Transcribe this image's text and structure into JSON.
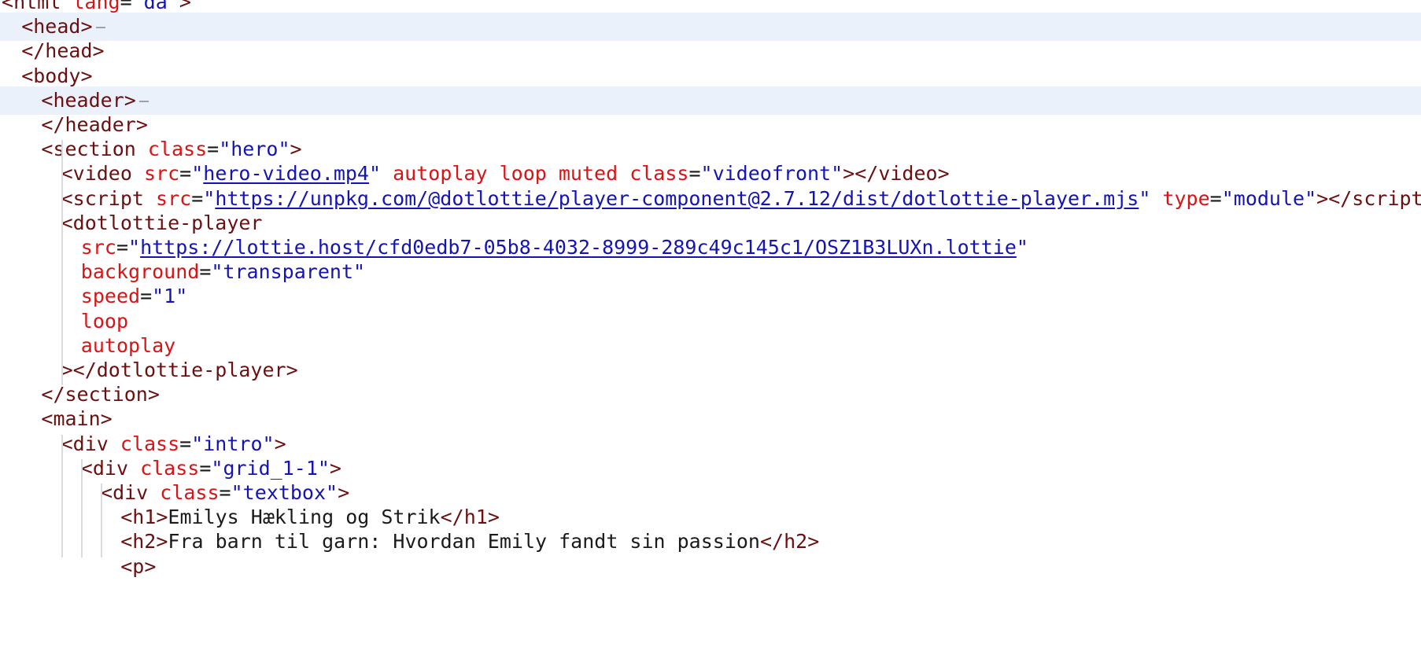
{
  "editor": {
    "lines": [
      {
        "indent": 0,
        "tokens": [
          {
            "t": "br",
            "v": "<"
          },
          {
            "t": "tag",
            "v": "html"
          },
          {
            "t": "txt",
            "v": " "
          },
          {
            "t": "attr",
            "v": "lang"
          },
          {
            "t": "txt",
            "v": "="
          },
          {
            "t": "val",
            "v": "\"da\""
          },
          {
            "t": "br",
            "v": ">"
          }
        ]
      },
      {
        "indent": 1,
        "highlight": true,
        "fold": true,
        "tokens": [
          {
            "t": "br",
            "v": "<"
          },
          {
            "t": "tag",
            "v": "head"
          },
          {
            "t": "br",
            "v": ">"
          }
        ]
      },
      {
        "indent": 1,
        "tokens": [
          {
            "t": "br",
            "v": "</"
          },
          {
            "t": "tag",
            "v": "head"
          },
          {
            "t": "br",
            "v": ">"
          }
        ]
      },
      {
        "indent": 1,
        "tokens": [
          {
            "t": "br",
            "v": "<"
          },
          {
            "t": "tag",
            "v": "body"
          },
          {
            "t": "br",
            "v": ">"
          }
        ]
      },
      {
        "indent": 2,
        "highlight": true,
        "fold": true,
        "tokens": [
          {
            "t": "br",
            "v": "<"
          },
          {
            "t": "tag",
            "v": "header"
          },
          {
            "t": "br",
            "v": ">"
          }
        ]
      },
      {
        "indent": 2,
        "tokens": [
          {
            "t": "br",
            "v": "</"
          },
          {
            "t": "tag",
            "v": "header"
          },
          {
            "t": "br",
            "v": ">"
          }
        ]
      },
      {
        "indent": 2,
        "tokens": [
          {
            "t": "br",
            "v": "<"
          },
          {
            "t": "tag",
            "v": "section"
          },
          {
            "t": "txt",
            "v": " "
          },
          {
            "t": "attr",
            "v": "class"
          },
          {
            "t": "txt",
            "v": "="
          },
          {
            "t": "val",
            "v": "\"hero\""
          },
          {
            "t": "br",
            "v": ">"
          }
        ]
      },
      {
        "indent": 3,
        "tokens": [
          {
            "t": "br",
            "v": "<"
          },
          {
            "t": "tag",
            "v": "video"
          },
          {
            "t": "txt",
            "v": " "
          },
          {
            "t": "attr",
            "v": "src"
          },
          {
            "t": "txt",
            "v": "="
          },
          {
            "t": "val",
            "v": "\""
          },
          {
            "t": "link",
            "v": "hero-video.mp4"
          },
          {
            "t": "val",
            "v": "\""
          },
          {
            "t": "txt",
            "v": " "
          },
          {
            "t": "attr",
            "v": "autoplay"
          },
          {
            "t": "txt",
            "v": " "
          },
          {
            "t": "attr",
            "v": "loop"
          },
          {
            "t": "txt",
            "v": " "
          },
          {
            "t": "attr",
            "v": "muted"
          },
          {
            "t": "txt",
            "v": " "
          },
          {
            "t": "attr",
            "v": "class"
          },
          {
            "t": "txt",
            "v": "="
          },
          {
            "t": "val",
            "v": "\"videofront\""
          },
          {
            "t": "br",
            "v": "></"
          },
          {
            "t": "tag",
            "v": "video"
          },
          {
            "t": "br",
            "v": ">"
          }
        ]
      },
      {
        "indent": 3,
        "tokens": [
          {
            "t": "br",
            "v": "<"
          },
          {
            "t": "tag",
            "v": "script"
          },
          {
            "t": "txt",
            "v": " "
          },
          {
            "t": "attr",
            "v": "src"
          },
          {
            "t": "txt",
            "v": "="
          },
          {
            "t": "val",
            "v": "\""
          },
          {
            "t": "link",
            "v": "https://unpkg.com/@dotlottie/player-component@2.7.12/dist/dotlottie-player.mjs"
          },
          {
            "t": "val",
            "v": "\""
          },
          {
            "t": "txt",
            "v": " "
          },
          {
            "t": "attr",
            "v": "type"
          },
          {
            "t": "txt",
            "v": "="
          },
          {
            "t": "val",
            "v": "\"module\""
          },
          {
            "t": "br",
            "v": "></"
          },
          {
            "t": "tag",
            "v": "script"
          },
          {
            "t": "br",
            "v": ">"
          }
        ]
      },
      {
        "indent": 3,
        "tokens": [
          {
            "t": "br",
            "v": "<"
          },
          {
            "t": "tag",
            "v": "dotlottie-player"
          }
        ]
      },
      {
        "indent": 4,
        "tokens": [
          {
            "t": "attr",
            "v": "src"
          },
          {
            "t": "txt",
            "v": "="
          },
          {
            "t": "val",
            "v": "\""
          },
          {
            "t": "link",
            "v": "https://lottie.host/cfd0edb7-05b8-4032-8999-289c49c145c1/OSZ1B3LUXn.lottie"
          },
          {
            "t": "val",
            "v": "\""
          }
        ]
      },
      {
        "indent": 4,
        "tokens": [
          {
            "t": "attr",
            "v": "background"
          },
          {
            "t": "txt",
            "v": "="
          },
          {
            "t": "val",
            "v": "\"transparent\""
          }
        ]
      },
      {
        "indent": 4,
        "tokens": [
          {
            "t": "attr",
            "v": "speed"
          },
          {
            "t": "txt",
            "v": "="
          },
          {
            "t": "val",
            "v": "\"1\""
          }
        ]
      },
      {
        "indent": 4,
        "tokens": [
          {
            "t": "attr",
            "v": "loop"
          }
        ]
      },
      {
        "indent": 4,
        "tokens": [
          {
            "t": "attr",
            "v": "autoplay"
          }
        ]
      },
      {
        "indent": 3,
        "tokens": [
          {
            "t": "br",
            "v": "></"
          },
          {
            "t": "tag",
            "v": "dotlottie-player"
          },
          {
            "t": "br",
            "v": ">"
          }
        ]
      },
      {
        "indent": 2,
        "tokens": [
          {
            "t": "br",
            "v": "</"
          },
          {
            "t": "tag",
            "v": "section"
          },
          {
            "t": "br",
            "v": ">"
          }
        ]
      },
      {
        "indent": 2,
        "tokens": [
          {
            "t": "br",
            "v": "<"
          },
          {
            "t": "tag",
            "v": "main"
          },
          {
            "t": "br",
            "v": ">"
          }
        ]
      },
      {
        "indent": 3,
        "tokens": [
          {
            "t": "br",
            "v": "<"
          },
          {
            "t": "tag",
            "v": "div"
          },
          {
            "t": "txt",
            "v": " "
          },
          {
            "t": "attr",
            "v": "class"
          },
          {
            "t": "txt",
            "v": "="
          },
          {
            "t": "val",
            "v": "\"intro\""
          },
          {
            "t": "br",
            "v": ">"
          }
        ]
      },
      {
        "indent": 4,
        "tokens": [
          {
            "t": "br",
            "v": "<"
          },
          {
            "t": "tag",
            "v": "div"
          },
          {
            "t": "txt",
            "v": " "
          },
          {
            "t": "attr",
            "v": "class"
          },
          {
            "t": "txt",
            "v": "="
          },
          {
            "t": "val",
            "v": "\"grid_1-1\""
          },
          {
            "t": "br",
            "v": ">"
          }
        ]
      },
      {
        "indent": 5,
        "tokens": [
          {
            "t": "br",
            "v": "<"
          },
          {
            "t": "tag",
            "v": "div"
          },
          {
            "t": "txt",
            "v": " "
          },
          {
            "t": "attr",
            "v": "class"
          },
          {
            "t": "txt",
            "v": "="
          },
          {
            "t": "val",
            "v": "\"textbox\""
          },
          {
            "t": "br",
            "v": ">"
          }
        ]
      },
      {
        "indent": 6,
        "tokens": [
          {
            "t": "br",
            "v": "<"
          },
          {
            "t": "tag",
            "v": "h1"
          },
          {
            "t": "br",
            "v": ">"
          },
          {
            "t": "txt",
            "v": "Emilys Hækling og Strik"
          },
          {
            "t": "br",
            "v": "</"
          },
          {
            "t": "tag",
            "v": "h1"
          },
          {
            "t": "br",
            "v": ">"
          }
        ]
      },
      {
        "indent": 6,
        "tokens": [
          {
            "t": "br",
            "v": "<"
          },
          {
            "t": "tag",
            "v": "h2"
          },
          {
            "t": "br",
            "v": ">"
          },
          {
            "t": "txt",
            "v": "Fra barn til garn: Hvordan Emily fandt sin passion"
          },
          {
            "t": "br",
            "v": "</"
          },
          {
            "t": "tag",
            "v": "h2"
          },
          {
            "t": "br",
            "v": ">"
          }
        ]
      },
      {
        "indent": 6,
        "tokens": [
          {
            "t": "br",
            "v": "<"
          },
          {
            "t": "tag",
            "v": "p"
          },
          {
            "t": "br",
            "v": ">"
          }
        ]
      }
    ]
  }
}
